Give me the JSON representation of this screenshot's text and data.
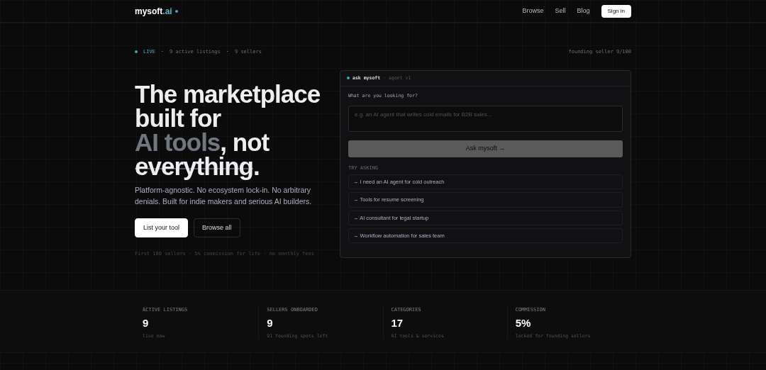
{
  "nav": {
    "logo": "mysoft",
    "logo_suffix": ".ai",
    "links": [
      "Browse",
      "Sell",
      "Blog"
    ],
    "sign_in": "Sign in"
  },
  "separator": "·",
  "status": {
    "live": "LIVE",
    "listings": "9 active listings",
    "sellers": "9 sellers",
    "founding": "founding seller 9/100"
  },
  "headline_lines": [
    [
      {
        "text": "The marketplace",
        "kind": "plain"
      }
    ],
    [
      {
        "text": "built for",
        "kind": "plain"
      }
    ],
    [
      {
        "text": "AI tools",
        "kind": "muted"
      },
      {
        "text": ", not",
        "kind": "plain"
      }
    ],
    [
      {
        "text": "everything",
        "kind": "struck"
      },
      {
        "text": ".",
        "kind": "plain"
      }
    ]
  ],
  "subtitle": "Platform-agnostic. No ecosystem lock-in. No arbitrary denials. Built for indie makers and serious AI builders.",
  "buttons": [
    {
      "label": "List your tool",
      "kind": "primary"
    },
    {
      "label": "Browse all",
      "kind": "outline"
    }
  ],
  "footnote": "First 100 sellers · 5% commission for life · no monthly fees",
  "agent": {
    "title": "ask mysoft",
    "version": "agent v1",
    "question": "What are you looking for?",
    "placeholder": "e.g. an AI agent that writes cold emails for B2B sales...",
    "submit": "Ask mysoft →",
    "try_label": "TRY ASKING",
    "suggestions": [
      "→ I need an AI agent for cold outreach",
      "→ Tools for resume screening",
      "→ AI consultant for legal startup",
      "→ Workflow automation for sales team"
    ]
  },
  "stats": [
    {
      "label": "ACTIVE LISTINGS",
      "value": "9",
      "note": "live now"
    },
    {
      "label": "SELLERS ONBOARDED",
      "value": "9",
      "note": "91 founding spots left"
    },
    {
      "label": "CATEGORIES",
      "value": "17",
      "note": "AI tools & services"
    },
    {
      "label": "COMMISSION",
      "value": "5%",
      "note": "locked for founding sellers"
    }
  ]
}
